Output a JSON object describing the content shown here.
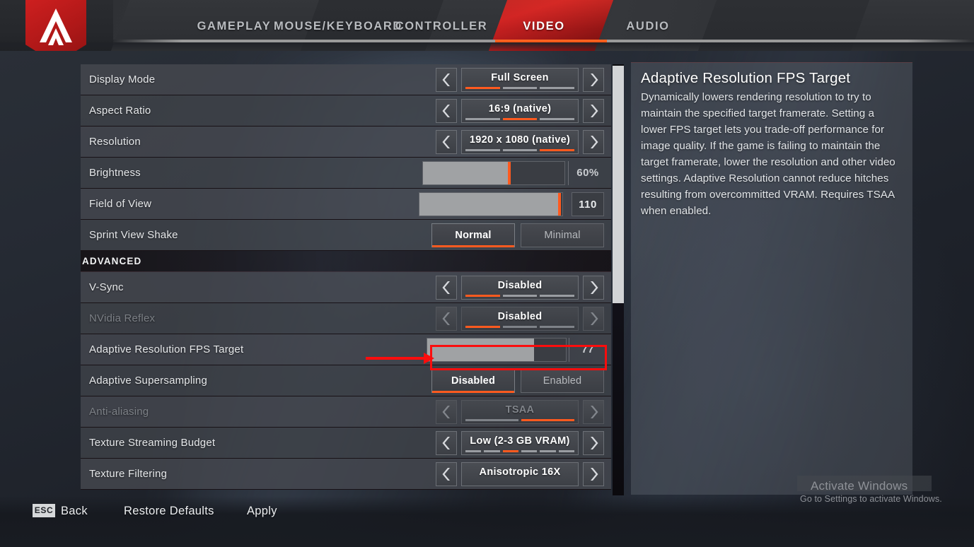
{
  "header": {
    "logo_name": "apex-legends-logo",
    "tabs": [
      {
        "label": "GAMEPLAY",
        "active": false
      },
      {
        "label": "MOUSE/KEYBOARD",
        "active": false
      },
      {
        "label": "CONTROLLER",
        "active": false
      },
      {
        "label": "VIDEO",
        "active": true
      },
      {
        "label": "AUDIO",
        "active": false
      }
    ]
  },
  "settings": {
    "rows": [
      {
        "label": "Display Mode",
        "type": "spinner",
        "value": "Full Screen",
        "segments": 3,
        "active_segment": 1,
        "disabled": false
      },
      {
        "label": "Aspect Ratio",
        "type": "spinner",
        "value": "16:9 (native)",
        "segments": 3,
        "active_segment": 2,
        "disabled": false
      },
      {
        "label": "Resolution",
        "type": "spinner",
        "value": "1920 x 1080 (native)",
        "segments": 3,
        "active_segment": 3,
        "disabled": false
      },
      {
        "label": "Brightness",
        "type": "slider",
        "value": "60%",
        "fill_percent": 60,
        "disabled": false
      },
      {
        "label": "Field of View",
        "type": "slider",
        "value": "110",
        "fill_percent": 97,
        "disabled": false
      },
      {
        "label": "Sprint View Shake",
        "type": "toggle",
        "options": [
          "Normal",
          "Minimal"
        ],
        "selected": "Normal",
        "disabled": false
      },
      {
        "label": "ADVANCED",
        "type": "section"
      },
      {
        "label": "V-Sync",
        "type": "spinner",
        "value": "Disabled",
        "segments": 3,
        "active_segment": 1,
        "disabled": false
      },
      {
        "label": "NVidia Reflex",
        "type": "spinner",
        "value": "Disabled",
        "segments": 3,
        "active_segment": 1,
        "disabled": true
      },
      {
        "label": "Adaptive Resolution FPS Target",
        "type": "slider",
        "value": "77",
        "fill_percent": 77,
        "disabled": false,
        "highlighted": true
      },
      {
        "label": "Adaptive Supersampling",
        "type": "toggle",
        "options": [
          "Disabled",
          "Enabled"
        ],
        "selected": "Disabled",
        "disabled": false
      },
      {
        "label": "Anti-aliasing",
        "type": "spinner",
        "value": "TSAA",
        "segments": 2,
        "active_segment": 2,
        "disabled": true
      },
      {
        "label": "Texture Streaming Budget",
        "type": "spinner",
        "value": "Low (2-3 GB VRAM)",
        "segments": 6,
        "active_segment": 3,
        "disabled": false
      },
      {
        "label": "Texture Filtering",
        "type": "spinner",
        "value": "Anisotropic 16X",
        "segments": 0,
        "active_segment": 0,
        "disabled": false
      }
    ]
  },
  "description": {
    "title": "Adaptive Resolution FPS Target",
    "body": "Dynamically lowers rendering resolution to try to maintain the specified target framerate. Setting a lower FPS target lets you trade-off performance for image quality. If the game is failing to maintain the target framerate, lower the resolution and other video settings. Adaptive Resolution cannot reduce hitches resulting from overcommitted VRAM. Requires TSAA when enabled."
  },
  "footer": {
    "esc_key": "ESC",
    "back_label": "Back",
    "restore_label": "Restore Defaults",
    "apply_label": "Apply"
  },
  "watermark": {
    "title": "Activate Windows",
    "subtitle": "Go to Settings to activate Windows."
  },
  "annotation": {
    "color": "#fb0d0d",
    "target": "Adaptive Resolution FPS Target slider"
  },
  "colors": {
    "accent_orange": "#ff5a1f",
    "brand_red": "#cf2222",
    "annotation_red": "#fb0d0d"
  }
}
